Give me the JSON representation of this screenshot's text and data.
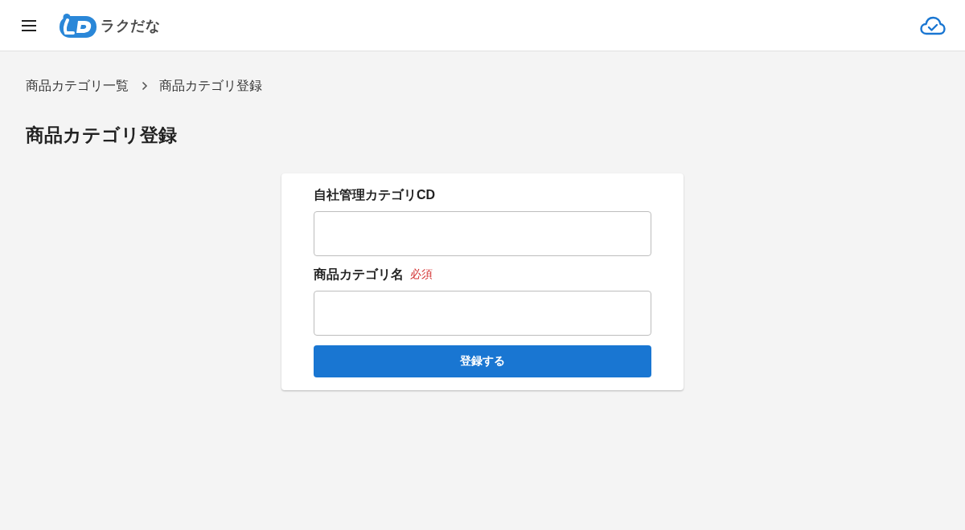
{
  "header": {
    "brand": "ラクだな"
  },
  "breadcrumb": [
    {
      "label": "商品カテゴリ一覧"
    },
    {
      "label": "商品カテゴリ登録"
    }
  ],
  "page_title": "商品カテゴリ登録",
  "form": {
    "fields": [
      {
        "label": "自社管理カテゴリCD"
      },
      {
        "label": "商品カテゴリ名",
        "badge": "必須"
      }
    ],
    "submit": "登録する"
  }
}
